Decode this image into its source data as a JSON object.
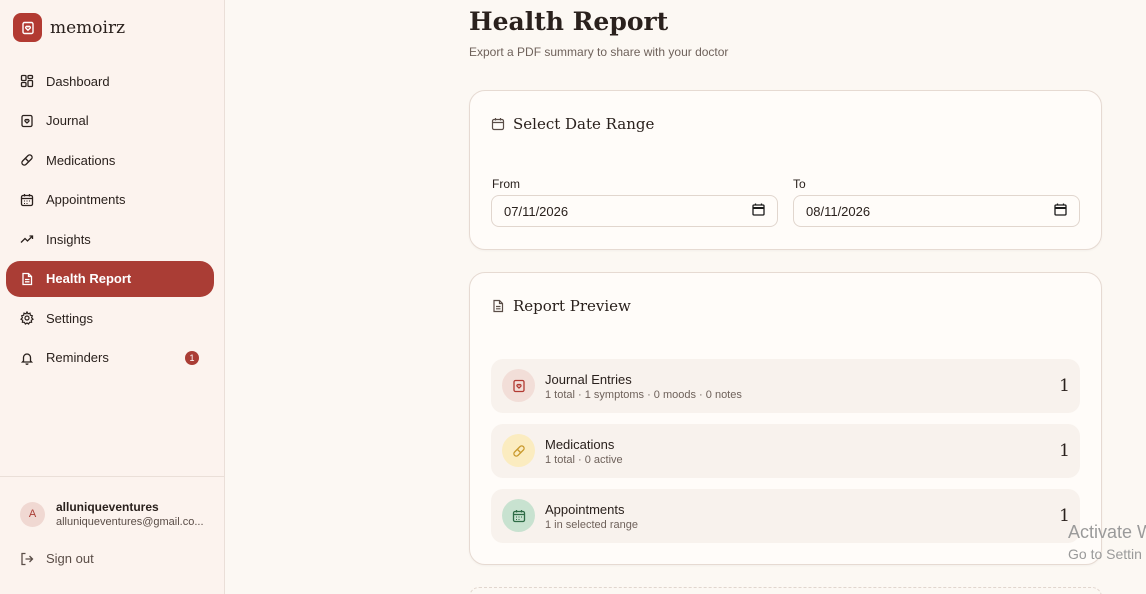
{
  "brand": {
    "name": "memoirz"
  },
  "nav": {
    "items": [
      {
        "label": "Dashboard"
      },
      {
        "label": "Journal"
      },
      {
        "label": "Medications"
      },
      {
        "label": "Appointments"
      },
      {
        "label": "Insights"
      },
      {
        "label": "Health Report"
      },
      {
        "label": "Settings"
      },
      {
        "label": "Reminders",
        "badge": "1"
      }
    ]
  },
  "user": {
    "initial": "A",
    "name": "alluniqueventures",
    "email": "alluniqueventures@gmail.co..."
  },
  "signout": {
    "label": "Sign out"
  },
  "page": {
    "title": "Health Report",
    "subtitle": "Export a PDF summary to share with your doctor"
  },
  "date_range": {
    "title": "Select Date Range",
    "from_label": "From",
    "from_value": "07/11/2026",
    "to_label": "To",
    "to_value": "08/11/2026"
  },
  "preview": {
    "title": "Report Preview",
    "rows": [
      {
        "name": "Journal Entries",
        "detail": "1 total · 1 symptoms · 0 moods · 0 notes",
        "value": "1"
      },
      {
        "name": "Medications",
        "detail": "1 total · 0 active",
        "value": "1"
      },
      {
        "name": "Appointments",
        "detail": "1 in selected range",
        "value": "1"
      }
    ]
  },
  "watermark": {
    "line1": "Activate W",
    "line2": "Go to Settin"
  },
  "colors": {
    "accent": "#aa3d35",
    "background": "#fcf8f3",
    "sidebar": "#fcf3ee"
  }
}
